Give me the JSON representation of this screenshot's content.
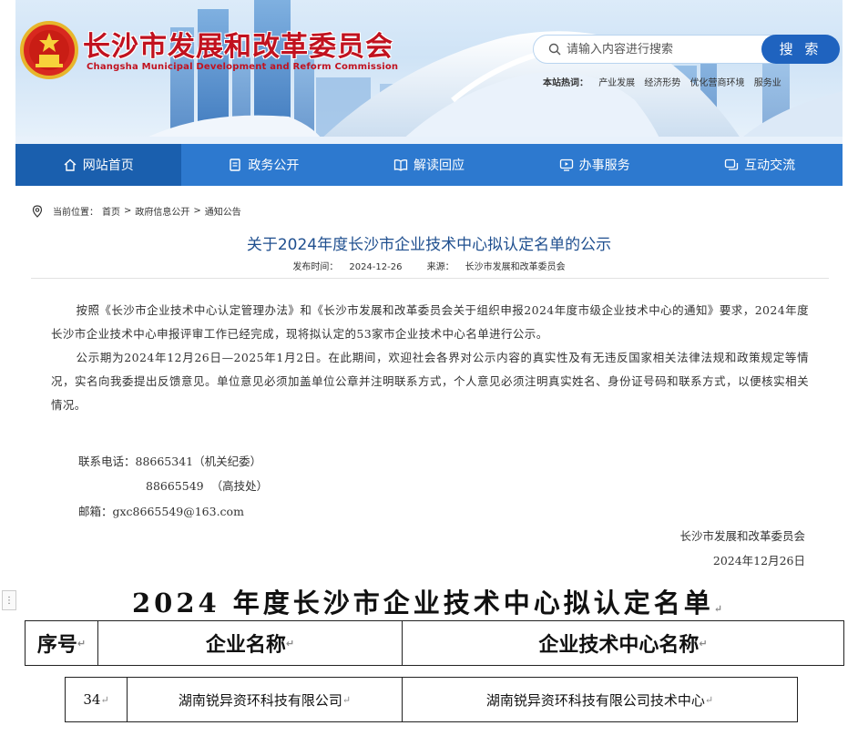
{
  "header": {
    "site_title": "长沙市发展和改革委员会",
    "site_subtitle": "Changsha Municipal Development and Reform Commission",
    "search_placeholder": "请输入内容进行搜索",
    "search_button": "搜 索",
    "hotwords_label": "本站热词：",
    "hotwords": [
      "产业发展",
      "经济形势",
      "优化营商环境",
      "服务业"
    ]
  },
  "nav": {
    "items": [
      {
        "label": "网站首页",
        "icon": "home-icon"
      },
      {
        "label": "政务公开",
        "icon": "document-icon"
      },
      {
        "label": "解读回应",
        "icon": "book-icon"
      },
      {
        "label": "办事服务",
        "icon": "monitor-icon"
      },
      {
        "label": "互动交流",
        "icon": "chat-icon"
      }
    ]
  },
  "breadcrumb": {
    "prefix": "当前位置：",
    "path": [
      "首页",
      "政府信息公开",
      "通知公告"
    ],
    "separator": ">"
  },
  "article": {
    "title": "关于2024年度长沙市企业技术中心拟认定名单的公示",
    "date_label": "发布时间：",
    "date": "2024-12-26",
    "source_label": "来源：",
    "source": "长沙市发展和改革委员会",
    "paragraphs": [
      "按照《长沙市企业技术中心认定管理办法》和《长沙市发展和改革委员会关于组织申报2024年度市级企业技术中心的通知》要求，2024年度长沙市企业技术中心申报评审工作已经完成，现将拟认定的53家市企业技术中心名单进行公示。",
      "公示期为2024年12月26日—2025年1月2日。在此期间，欢迎社会各界对公示内容的真实性及有无违反国家相关法律法规和政策规定等情况，实名向我委提出反馈意见。单位意见必须加盖单位公章并注明联系方式，个人意见必须注明真实姓名、身份证号码和联系方式，以便核实相关情况。"
    ],
    "contact": {
      "phone_line1": "联系电话：88665341（机关纪委）",
      "phone_line2": "88665549  （高技处）",
      "email": "邮箱：gxc8665549@163.com"
    },
    "signature_org": "长沙市发展和改革委员会",
    "signature_date": "2024年12月26日"
  },
  "document": {
    "title": "2024 年度长沙市企业技术中心拟认定名单",
    "handle_glyph": "⋮",
    "return_mark": "↵",
    "table_headers": [
      "序号",
      "企业名称",
      "企业技术中心名称"
    ],
    "rows": [
      {
        "no": "34",
        "company": "湖南锐异资环科技有限公司",
        "center": "湖南锐异资环科技有限公司技术中心"
      }
    ]
  },
  "colors": {
    "brand_red": "#c1121f",
    "nav_blue": "#2d79cf",
    "nav_active": "#1a5fae",
    "title_blue": "#1f4f8f",
    "button_blue": "#1f63bf"
  }
}
